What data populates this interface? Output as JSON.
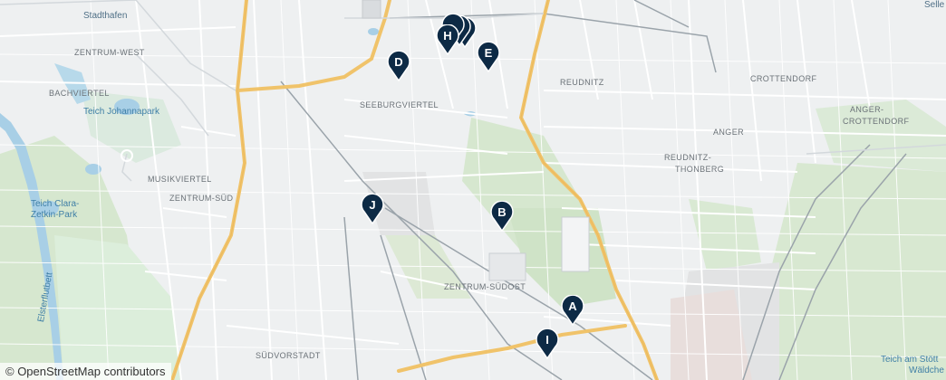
{
  "map": {
    "districts": {
      "stadthafen": "Stadthafen",
      "zentrum_west": "ZENTRUM-WEST",
      "bachviertel": "BACHVIERTEL",
      "teich_johannapark": "Teich Johannapark",
      "musikviertel": "MUSIKVIERTEL",
      "zentrum_sued": "ZENTRUM-SÜD",
      "seeburgviertel": "SEEBURGVIERTEL",
      "reudnitz": "REUDNITZ",
      "crottendorf": "CROTTENDORF",
      "anger": "ANGER",
      "anger_crottendorf_1": "ANGER-",
      "anger_crottendorf_2": "CROTTENDORF",
      "reudnitz_thonberg_1": "REUDNITZ-",
      "reudnitz_thonberg_2": "THONBERG",
      "zentrum_suedost": "ZENTRUM-SÜDOST",
      "suedvorstadt": "SÜDVORSTADT",
      "sellerhausen": "Selle",
      "teich_clara_1": "Teich Clara-",
      "teich_clara_2": "Zetkin-Park",
      "elsterflutbett": "Elsterflutbett",
      "teich_stoett_1": "Teich am Stött",
      "teich_stoett_2": "Wäldche"
    },
    "markers": [
      {
        "letter": "A"
      },
      {
        "letter": "B"
      },
      {
        "letter": "D"
      },
      {
        "letter": "E"
      },
      {
        "letter": "H"
      },
      {
        "letter": "I"
      },
      {
        "letter": "J"
      }
    ],
    "marker_color": "#0d2a45",
    "attribution": "© OpenStreetMap contributors"
  }
}
